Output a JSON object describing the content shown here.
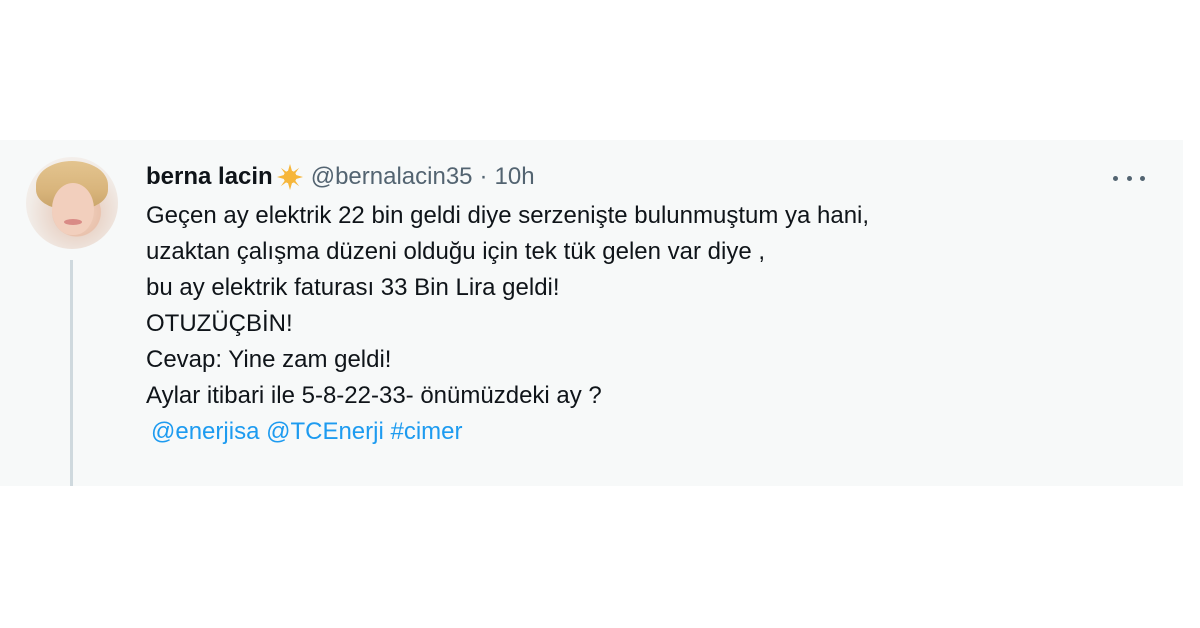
{
  "tweet": {
    "display_name": "berna lacin",
    "badge_icon": "sun-emoji-icon",
    "handle": "@bernalacin35",
    "separator": "·",
    "time": "10h",
    "more_icon": "more-options-icon",
    "lines": [
      "Geçen ay elektrik 22 bin geldi diye serzenişte bulunmuştum ya hani,",
      "uzaktan çalışma düzeni olduğu için tek tük gelen var diye ,",
      "bu ay elektrik faturası 33 Bin Lira geldi!",
      "OTUZÜÇBİN!",
      "Cevap: Yine zam geldi!",
      "Aylar itibari ile 5-8-22-33- önümüzdeki ay ?"
    ],
    "mentions": [
      "@enerjisa",
      "@TCEnerji",
      "#cimer"
    ]
  },
  "colors": {
    "link": "#1d9bf0",
    "text": "#0f1419",
    "muted": "#536471",
    "card_background": "#f7f9f9"
  }
}
